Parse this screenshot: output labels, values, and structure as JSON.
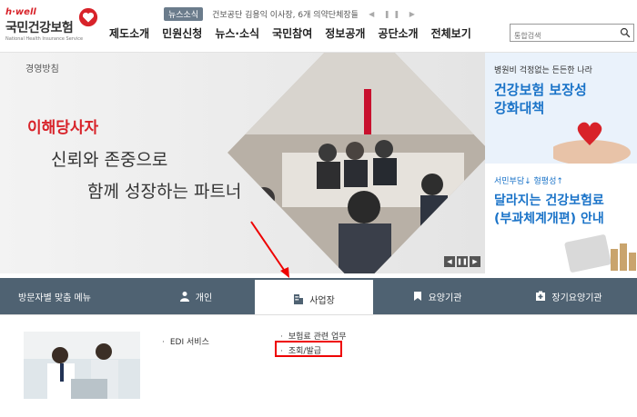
{
  "header": {
    "logo_hwell": "h·well",
    "logo_name": "국민건강보험",
    "logo_eng": "National Health Insurance Service",
    "news_badge": "뉴스소식",
    "news_text": "건보공단 김용익 이사장, 6개 의약단체장들과...",
    "news_controls": "◀ ❚❚ ▶",
    "search_placeholder": "통합검색"
  },
  "gnb": [
    "제도소개",
    "민원신청",
    "뉴스·소식",
    "국민참여",
    "정보공개",
    "공단소개",
    "전체보기"
  ],
  "banner": {
    "tag": "경영방침",
    "title": "이해당사자",
    "line1": "신뢰와 존중으로",
    "line2": "함께 성장하는 파트너",
    "controls": [
      "◀",
      "❚❚",
      "▶"
    ]
  },
  "side_banner_1": {
    "small": "병원비 걱정없는 든든한 나라",
    "big1": "건강보험 보장성",
    "big2": "강화대책"
  },
  "side_banner_2": {
    "small": "서민부담↓ 형평성↑",
    "big1": "달라지는 건강보험료",
    "big2": "(부과체계개편) 안내"
  },
  "menubar": {
    "label": "방문자별 맞춤 메뉴",
    "tabs": [
      {
        "label": "개인",
        "icon": "person-icon"
      },
      {
        "label": "사업장",
        "icon": "building-icon"
      },
      {
        "label": "요양기관",
        "icon": "bookmark-icon"
      },
      {
        "label": "장기요양기관",
        "icon": "cross-box-icon"
      }
    ],
    "active": "사업장"
  },
  "content": {
    "links_col1": [
      "EDI 서비스"
    ],
    "links_col2": [
      "보험료 관련 업무",
      "조회/발급"
    ]
  },
  "colors": {
    "brand_red": "#d8232a",
    "menubar": "#4f6272",
    "accent_blue": "#1a73c8",
    "highlight": "#ee0000"
  }
}
